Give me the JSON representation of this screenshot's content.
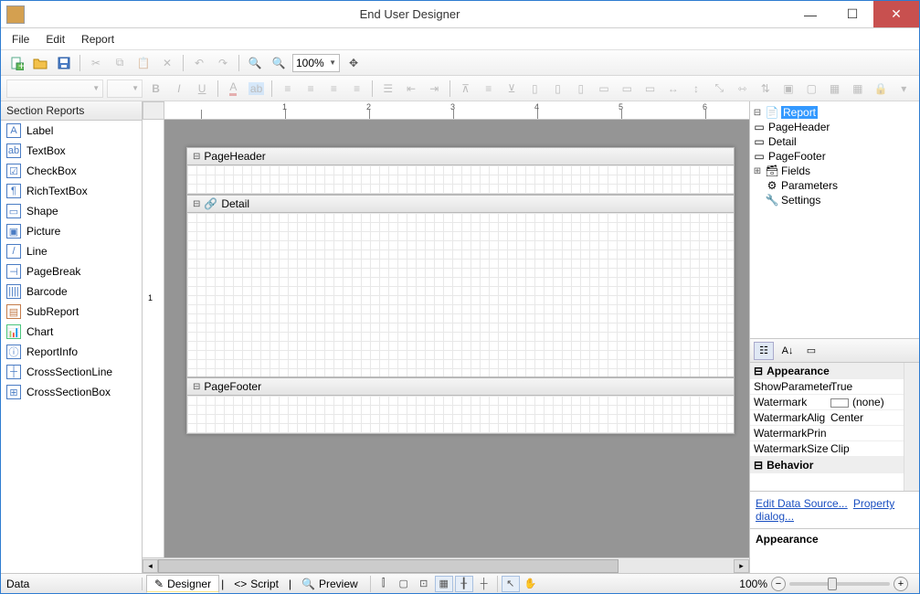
{
  "window": {
    "title": "End User Designer"
  },
  "menu": [
    "File",
    "Edit",
    "Report"
  ],
  "toolbar1": {
    "zoom": "100%"
  },
  "toolbox": {
    "header": "Section Reports",
    "items": [
      "Label",
      "TextBox",
      "CheckBox",
      "RichTextBox",
      "Shape",
      "Picture",
      "Line",
      "PageBreak",
      "Barcode",
      "SubReport",
      "Chart",
      "ReportInfo",
      "CrossSectionLine",
      "CrossSectionBox"
    ]
  },
  "sections": {
    "pageHeader": "PageHeader",
    "detail": "Detail",
    "pageFooter": "PageFooter"
  },
  "tree": {
    "report": "Report",
    "pageHeader": "PageHeader",
    "detail": "Detail",
    "pageFooter": "PageFooter",
    "fields": "Fields",
    "parameters": "Parameters",
    "settings": "Settings"
  },
  "propgrid": {
    "cat1": "Appearance",
    "rows": [
      {
        "k": "ShowParameterUI",
        "v": "True"
      },
      {
        "k": "Watermark",
        "v": "(none)"
      },
      {
        "k": "WatermarkAlignment",
        "v": "Center"
      },
      {
        "k": "WatermarkPrintOnPages",
        "v": ""
      },
      {
        "k": "WatermarkSizeMode",
        "v": "Clip"
      }
    ],
    "cat2": "Behavior",
    "link1": "Edit Data Source...",
    "link2": "Property dialog...",
    "descHeader": "Appearance"
  },
  "tabs": {
    "designer": "Designer",
    "script": "Script",
    "preview": "Preview"
  },
  "statusbar": {
    "data": "Data",
    "zoom": "100%"
  },
  "ruler": {
    "marks": [
      "1",
      "2",
      "3",
      "4",
      "5",
      "6"
    ]
  }
}
